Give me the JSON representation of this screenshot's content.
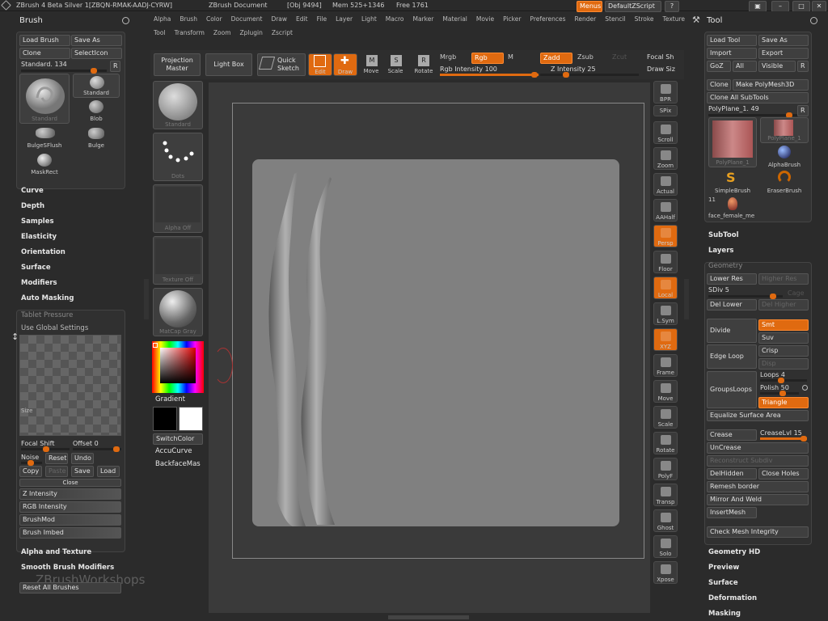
{
  "titlebar": {
    "app": "ZBrush 4 Beta Silver 1[ZBQN-RMAK-AADJ-CYRW]",
    "doc": "ZBrush Document",
    "obj": "[Obj 9494]",
    "mem": "Mem 525+1346",
    "free": "Free 1761",
    "menus_btn": "Menus",
    "script_btn": "DefaultZScript"
  },
  "menubar": {
    "row1": [
      "Alpha",
      "Brush",
      "Color",
      "Document",
      "Draw",
      "Edit",
      "File",
      "Layer",
      "Light",
      "Macro",
      "Marker",
      "Material",
      "Movie",
      "Picker",
      "Preferences",
      "Render",
      "Stencil",
      "Stroke",
      "Texture"
    ],
    "row2": [
      "Tool",
      "Transform",
      "Zoom",
      "Zplugin",
      "Zscript"
    ]
  },
  "left": {
    "title": "Brush",
    "load": "Load Brush",
    "save": "Save As",
    "clone": "Clone",
    "select_icon": "SelectIcon",
    "current": "Standard. 134",
    "r": "R",
    "brushes": [
      {
        "label": "Standard"
      },
      {
        "label": "Standard"
      },
      {
        "label": "Blob"
      },
      {
        "label": "BulgeSFlush"
      },
      {
        "label": "Bulge"
      },
      {
        "label": "MaskRect"
      }
    ],
    "sections": [
      "Curve",
      "Depth",
      "Samples",
      "Elasticity",
      "Orientation",
      "Surface",
      "Modifiers",
      "Auto Masking"
    ],
    "tablet": "Tablet Pressure",
    "global": "Use Global Settings",
    "size": "Size",
    "focal": "Focal Shift",
    "offset": "Offset 0",
    "noise": "Noise",
    "reset": "Reset",
    "undo": "Undo",
    "copy": "Copy",
    "paste": "Paste",
    "save2": "Save",
    "load2": "Load",
    "close": "Close",
    "curves": [
      "Z Intensity",
      "RGB Intensity",
      "BrushMod",
      "Brush Imbed"
    ],
    "alpha_texture": "Alpha and Texture",
    "smooth": "Smooth Brush Modifiers",
    "reset_all": "Reset All Brushes",
    "watermark": "ZBrushWorkshops"
  },
  "shelf": {
    "proj": "Projection\nMaster",
    "lightbox": "Light Box",
    "quicksketch": "Quick\nSketch",
    "edit": "Edit",
    "draw": "Draw",
    "move": "Move",
    "scale": "Scale",
    "rotate": "Rotate",
    "mrgb": "Mrgb",
    "rgb": "Rgb",
    "m": "M",
    "rgb_int": "Rgb Intensity 100",
    "zadd": "Zadd",
    "zsub": "Zsub",
    "zcut": "Zcut",
    "z_int": "Z Intensity 25",
    "focal": "Focal Sh",
    "draw_size": "Draw Siz",
    "slots": [
      "Standard",
      "Dots",
      "Alpha Off",
      "Texture Off",
      "MatCap Gray"
    ],
    "gradient": "Gradient",
    "switch": "SwitchColor",
    "accu": "AccuCurve",
    "backface": "BackfaceMas"
  },
  "right_tools": [
    "BPR",
    "SPix",
    "Scroll",
    "Zoom",
    "Actual",
    "AAHalf",
    "Persp",
    "Floor",
    "Local",
    "L.Sym",
    "XYZ",
    "Frame",
    "Move",
    "Scale",
    "Rotate",
    "PolyF",
    "Transp",
    "Ghost",
    "Solo",
    "Xpose"
  ],
  "tool": {
    "title": "Tool",
    "load": "Load Tool",
    "save": "Save As",
    "import": "Import",
    "export": "Export",
    "goz": "GoZ",
    "all": "All",
    "visible": "Visible",
    "r": "R",
    "clone": "Clone",
    "make": "Make PolyMesh3D",
    "clone_all": "Clone All SubTools",
    "current": "PolyPlane_1. 49",
    "thumbs": [
      {
        "label": "PolyPlane_1"
      },
      {
        "label": "PolyPlane_1"
      },
      {
        "label": "AlphaBrush"
      },
      {
        "label": "SimpleBrush"
      },
      {
        "label": "EraserBrush"
      }
    ],
    "count": "11",
    "face": "face_female_me",
    "subtool": "SubTool",
    "layers": "Layers",
    "geometry": "Geometry",
    "lower": "Lower Res",
    "higher": "Higher Res",
    "sdiv": "SDiv 5",
    "cage": "Cage",
    "del_lower": "Del Lower",
    "del_higher": "Del Higher",
    "divide": "Divide",
    "smt": "Smt",
    "suv": "Suv",
    "edge_loop": "Edge Loop",
    "crisp": "Crisp",
    "disp": "Disp",
    "groups_loops": "GroupsLoops",
    "loops": "Loops 4",
    "polish": "Polish 50",
    "triangle": "Triangle",
    "equalize": "Equalize Surface Area",
    "crease": "Crease",
    "crease_lvl": "CreaseLvl 15",
    "uncrease": "UnCrease",
    "reconstruct": "Reconstruct Subdiv",
    "delhidden": "DelHidden",
    "close_holes": "Close Holes",
    "remesh": "Remesh border",
    "mirror": "Mirror And Weld",
    "insert": "InsertMesh",
    "check": "Check Mesh Integrity",
    "geom_hd": "Geometry HD",
    "preview": "Preview",
    "surface": "Surface",
    "deformation": "Deformation",
    "masking": "Masking"
  },
  "colors": {
    "accent": "#e06a10",
    "bg": "#2b2b2b",
    "canvas": "#7f7f7f"
  }
}
